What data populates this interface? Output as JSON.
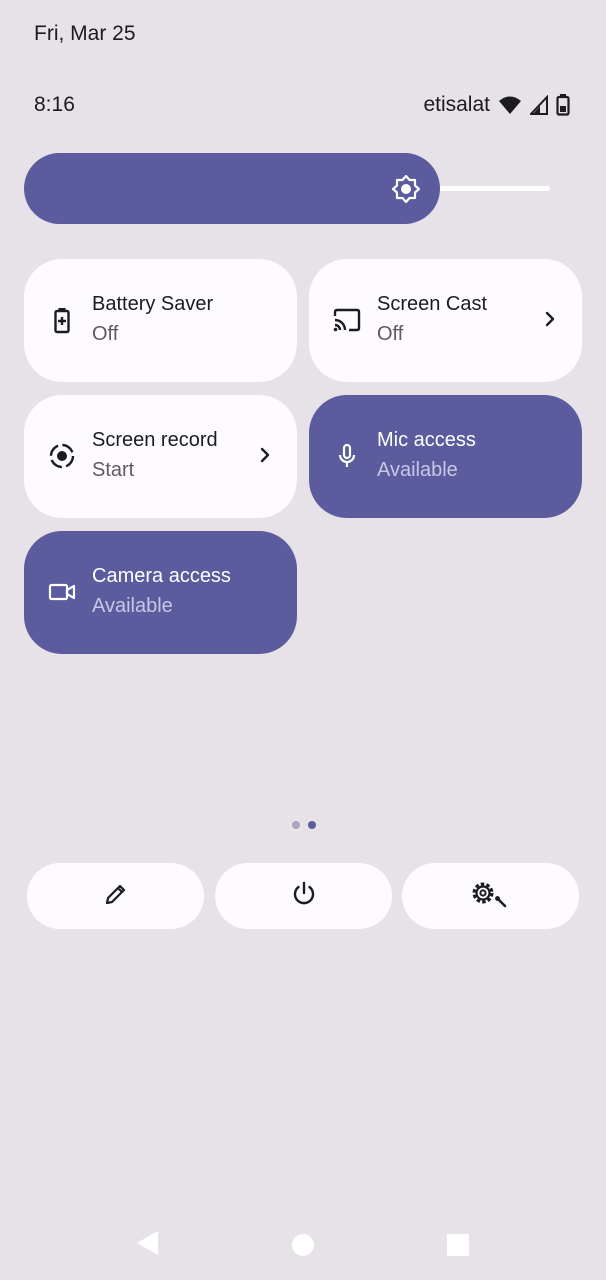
{
  "status_bar": {
    "date": "Fri, Mar 25",
    "time": "8:16",
    "carrier": "etisalat",
    "icons": [
      "wifi-icon",
      "signal-icon",
      "battery-icon"
    ]
  },
  "brightness": {
    "level_fraction": 0.79,
    "icon": "brightness-icon"
  },
  "tiles": [
    {
      "title": "Battery Saver",
      "subtitle": "Off",
      "icon": "battery-saver-icon",
      "active": false
    },
    {
      "title": "Screen Cast",
      "subtitle": "Off",
      "icon": "cast-icon",
      "active": false,
      "chevron": true
    },
    {
      "title": "Screen record",
      "subtitle": "Start",
      "icon": "screen-record-icon",
      "active": false,
      "chevron": true
    },
    {
      "title": "Mic access",
      "subtitle": "Available",
      "icon": "mic-icon",
      "active": true
    },
    {
      "title": "Camera access",
      "subtitle": "Available",
      "icon": "camera-icon",
      "active": true
    }
  ],
  "pager": {
    "pages": 2,
    "current": 2
  },
  "footer_buttons": [
    "edit-icon",
    "power-icon",
    "settings-icon"
  ],
  "nav_bar": [
    "back-icon",
    "home-icon",
    "recents-icon"
  ],
  "colors": {
    "accent": "#5b5b9e",
    "background": "#e6e2e8",
    "tile": "#fdfbfe"
  }
}
